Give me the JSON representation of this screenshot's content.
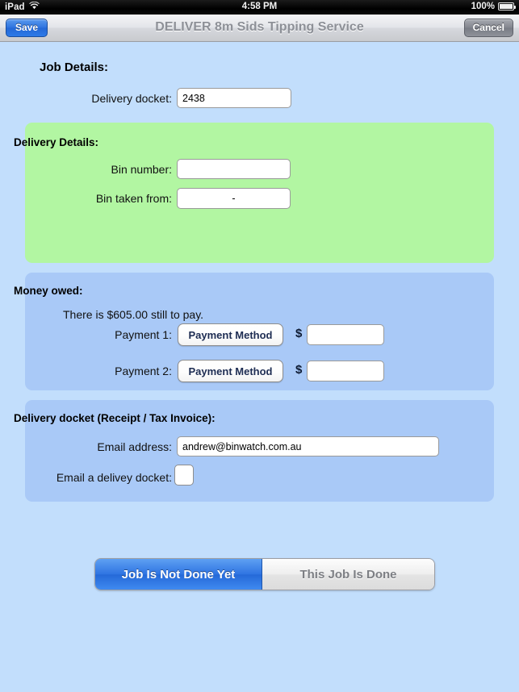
{
  "status_bar": {
    "device": "iPad",
    "wifi_icon": "wifi-icon",
    "time": "4:58 PM",
    "battery_percent": "100%",
    "battery_icon": "battery-full-icon"
  },
  "nav_bar": {
    "save_label": "Save",
    "title": "DELIVER 8m Sids Tipping Service",
    "cancel_label": "Cancel"
  },
  "job_details": {
    "heading": "Job Details:",
    "delivery_docket_label": "Delivery docket:",
    "delivery_docket_value": "2438"
  },
  "delivery_details": {
    "heading": "Delivery Details:",
    "bin_number_label": "Bin number:",
    "bin_number_value": "",
    "bin_taken_from_label": "Bin taken from:",
    "bin_taken_from_value": "-"
  },
  "money_owed": {
    "heading": "Money owed:",
    "balance_text": "There is $605.00 still to pay.",
    "payment_1_label": "Payment 1:",
    "payment_1_method": "Payment Method",
    "payment_1_currency": "$",
    "payment_1_amount": "",
    "payment_2_label": "Payment 2:",
    "payment_2_method": "Payment Method",
    "payment_2_currency": "$",
    "payment_2_amount": ""
  },
  "docket": {
    "heading": "Delivery docket (Receipt / Tax Invoice):",
    "email_address_label": "Email address:",
    "email_address_value": "andrew@binwatch.com.au",
    "email_docket_label": "Email a delivey docket:",
    "email_docket_checked": false
  },
  "job_status": {
    "not_done_label": "Job Is Not Done Yet",
    "done_label": "This Job Is Done",
    "selected": "Job Is Not Done Yet"
  },
  "colors": {
    "page_background": "#c2defc",
    "panel_blue": "#a9c9f7",
    "panel_green": "#b2f6a2",
    "accent_blue": "#2f74e2",
    "save_blue": "#2f74df"
  }
}
